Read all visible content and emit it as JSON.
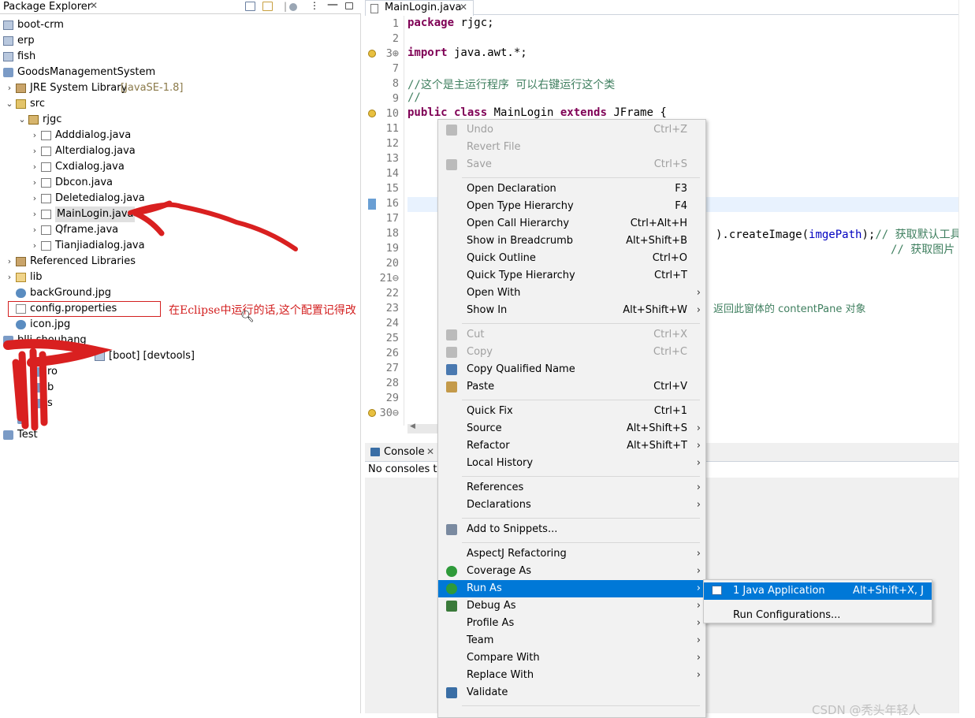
{
  "package_explorer": {
    "title": "Package Explorer",
    "close": "✕",
    "items": [
      {
        "label": "boot-crm",
        "icon": "maven-project-icon"
      },
      {
        "label": "erp",
        "icon": "maven-project-icon"
      },
      {
        "label": "fish",
        "icon": "maven-project-icon"
      },
      {
        "label": "GoodsManagementSystem",
        "icon": "java-project-icon"
      },
      {
        "label": "JRE System Library",
        "suffix": "[JavaSE-1.8]",
        "icon": "library-icon"
      },
      {
        "label": "src",
        "icon": "source-folder-icon"
      },
      {
        "label": "rjgc",
        "icon": "package-icon"
      },
      {
        "label": "Adddialog.java",
        "icon": "java-file-icon"
      },
      {
        "label": "Alterdialog.java",
        "icon": "java-file-icon"
      },
      {
        "label": "Cxdialog.java",
        "icon": "java-file-icon"
      },
      {
        "label": "Dbcon.java",
        "icon": "java-file-icon"
      },
      {
        "label": "Deletedialog.java",
        "icon": "java-file-icon"
      },
      {
        "label": "MainLogin.java",
        "icon": "java-file-icon"
      },
      {
        "label": "Qframe.java",
        "icon": "java-file-icon"
      },
      {
        "label": "Tianjiadialog.java",
        "icon": "java-file-icon"
      },
      {
        "label": "Referenced Libraries",
        "icon": "library-icon"
      },
      {
        "label": "lib",
        "icon": "folder-icon"
      },
      {
        "label": "backGround.jpg",
        "icon": "image-file-icon"
      },
      {
        "label": "config.properties",
        "icon": "properties-file-icon"
      },
      {
        "label": "icon.jpg",
        "icon": "image-file-icon"
      },
      {
        "label": "bllj-shouhang",
        "icon": "project-icon"
      },
      {
        "label": "[boot] [devtools]",
        "icon": "maven-project-icon"
      },
      {
        "label": "ro",
        "icon": "project-icon"
      },
      {
        "label": "b",
        "icon": "project-icon"
      },
      {
        "label": "s",
        "icon": "project-icon"
      },
      {
        "label": "t",
        "icon": "project-icon"
      },
      {
        "label": "Test",
        "icon": "project-icon"
      }
    ]
  },
  "annotation": {
    "text": "在Eclipse中运行的话,这个配置记得改"
  },
  "editor": {
    "tab_label": "MainLogin.java",
    "tab_close": "✕",
    "lines": [
      {
        "n": "1",
        "parts": [
          {
            "c": "kw",
            "t": "package"
          },
          {
            "c": "",
            "t": " rjgc;"
          }
        ]
      },
      {
        "n": "2",
        "parts": []
      },
      {
        "n": "3⊕",
        "parts": [
          {
            "c": "kw",
            "t": "import"
          },
          {
            "c": "",
            "t": " java.awt.*;"
          }
        ]
      },
      {
        "n": "7",
        "parts": []
      },
      {
        "n": "8",
        "parts": [
          {
            "c": "cm",
            "t": "//这个是主运行程序  可以右键运行这个类"
          }
        ]
      },
      {
        "n": "9",
        "parts": [
          {
            "c": "cm",
            "t": "//"
          }
        ]
      },
      {
        "n": "10",
        "parts": [
          {
            "c": "kw",
            "t": "public class"
          },
          {
            "c": "",
            "t": " MainLogin "
          },
          {
            "c": "kw",
            "t": "extends"
          },
          {
            "c": "",
            "t": " JFrame {"
          }
        ]
      },
      {
        "n": "11",
        "parts": []
      },
      {
        "n": "12",
        "parts": []
      },
      {
        "n": "13",
        "parts": []
      },
      {
        "n": "14",
        "parts": []
      },
      {
        "n": "15",
        "parts": []
      },
      {
        "n": "16",
        "parts": []
      },
      {
        "n": "17",
        "parts": []
      },
      {
        "n": "18",
        "parts": [
          {
            "c": "",
            "t": ").createImage("
          },
          {
            "c": "fd",
            "t": "imgePath"
          },
          {
            "c": "",
            "t": ");"
          },
          {
            "c": "cm",
            "t": "// 获取默认工具包"
          }
        ]
      },
      {
        "n": "19",
        "parts": [
          {
            "c": "cm",
            "t": "// 获取图片"
          }
        ]
      },
      {
        "n": "20",
        "parts": []
      },
      {
        "n": "21⊖",
        "parts": []
      },
      {
        "n": "22",
        "parts": []
      },
      {
        "n": "23",
        "parts": [
          {
            "c": "cm",
            "t": "返回此窗体的 contentPane 对象"
          }
        ]
      },
      {
        "n": "24",
        "parts": []
      },
      {
        "n": "25",
        "parts": []
      },
      {
        "n": "26",
        "parts": []
      },
      {
        "n": "27",
        "parts": []
      },
      {
        "n": "28",
        "parts": []
      },
      {
        "n": "29",
        "parts": []
      },
      {
        "n": "30⊖",
        "parts": []
      }
    ]
  },
  "console": {
    "tab_label": "Console",
    "tab_close": "✕",
    "message": "No consoles to"
  },
  "context_menu": {
    "items": [
      {
        "label": "Undo",
        "shortcut": "Ctrl+Z",
        "disabled": true,
        "icon": "undo-icon"
      },
      {
        "label": "Revert File",
        "shortcut": "",
        "disabled": true
      },
      {
        "label": "Save",
        "shortcut": "Ctrl+S",
        "disabled": true,
        "icon": "save-icon"
      },
      {
        "sep": true
      },
      {
        "label": "Open Declaration",
        "shortcut": "F3"
      },
      {
        "label": "Open Type Hierarchy",
        "shortcut": "F4"
      },
      {
        "label": "Open Call Hierarchy",
        "shortcut": "Ctrl+Alt+H"
      },
      {
        "label": "Show in Breadcrumb",
        "shortcut": "Alt+Shift+B"
      },
      {
        "label": "Quick Outline",
        "shortcut": "Ctrl+O"
      },
      {
        "label": "Quick Type Hierarchy",
        "shortcut": "Ctrl+T"
      },
      {
        "label": "Open With",
        "arrow": true
      },
      {
        "label": "Show In",
        "shortcut": "Alt+Shift+W",
        "arrow": true
      },
      {
        "sep": true
      },
      {
        "label": "Cut",
        "shortcut": "Ctrl+X",
        "disabled": true,
        "icon": "cut-icon"
      },
      {
        "label": "Copy",
        "shortcut": "Ctrl+C",
        "disabled": true,
        "icon": "copy-icon"
      },
      {
        "label": "Copy Qualified Name",
        "icon": "copy-qualified-icon"
      },
      {
        "label": "Paste",
        "shortcut": "Ctrl+V",
        "icon": "paste-icon"
      },
      {
        "sep": true
      },
      {
        "label": "Quick Fix",
        "shortcut": "Ctrl+1"
      },
      {
        "label": "Source",
        "shortcut": "Alt+Shift+S",
        "arrow": true
      },
      {
        "label": "Refactor",
        "shortcut": "Alt+Shift+T",
        "arrow": true
      },
      {
        "label": "Local History",
        "arrow": true
      },
      {
        "sep": true
      },
      {
        "label": "References",
        "arrow": true
      },
      {
        "label": "Declarations",
        "arrow": true
      },
      {
        "sep": true
      },
      {
        "label": "Add to Snippets...",
        "icon": "snippets-icon"
      },
      {
        "sep": true
      },
      {
        "label": "AspectJ Refactoring",
        "arrow": true
      },
      {
        "label": "Coverage As",
        "arrow": true,
        "icon": "coverage-icon"
      },
      {
        "label": "Run As",
        "arrow": true,
        "selected": true,
        "icon": "run-icon"
      },
      {
        "label": "Debug As",
        "arrow": true,
        "icon": "debug-icon"
      },
      {
        "label": "Profile As",
        "arrow": true
      },
      {
        "label": "Team",
        "arrow": true
      },
      {
        "label": "Compare With",
        "arrow": true
      },
      {
        "label": "Replace With",
        "arrow": true
      },
      {
        "label": "Validate",
        "icon": "validate-check-icon"
      },
      {
        "sep": true
      }
    ]
  },
  "submenu": {
    "items": [
      {
        "label": "1 Java Application",
        "shortcut": "Alt+Shift+X, J",
        "selected": true,
        "icon": "java-app-icon"
      },
      {
        "sep": true
      },
      {
        "label": "Run Configurations...",
        "shortcut": ""
      }
    ]
  },
  "watermark": "CSDN @秃头年轻人",
  "colors": {
    "accent": "#0078d7",
    "annotation_red": "#d32020",
    "keyword": "#7f0055",
    "comment": "#3f7f5f",
    "field": "#0000c0"
  }
}
